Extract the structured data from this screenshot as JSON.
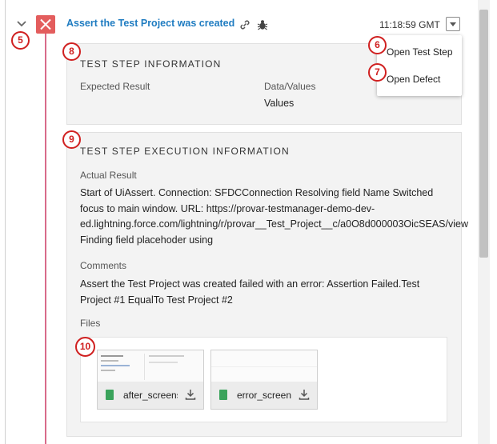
{
  "step": {
    "title": "Assert the Test Project was created",
    "time": "11:18:59 GMT"
  },
  "menu": {
    "open_test_step": "Open Test Step",
    "open_defect": "Open Defect"
  },
  "info": {
    "heading": "TEST STEP INFORMATION",
    "expected_label": "Expected Result",
    "data_label": "Data/Values",
    "data_value": "Values"
  },
  "exec": {
    "heading": "TEST STEP EXECUTION INFORMATION",
    "actual_label": "Actual Result",
    "actual_lines": [
      "Start of UiAssert. Connection: SFDCConnection Resolving field Name Switched",
      "focus to main window. URL: https://provar-testmanager-demo-dev-",
      "ed.lightning.force.com/lightning/r/provar__Test_Project__c/a0O8d000003OicSEAS/view",
      "Finding field placehoder using"
    ],
    "comments_label": "Comments",
    "comments_lines": [
      "Assert the Test Project was created failed with an error: Assertion Failed.Test",
      "Project #1 EqualTo Test Project #2"
    ],
    "files_label": "Files",
    "files": [
      {
        "name": "after_screenshot.png"
      },
      {
        "name": "error_screenshot.png"
      }
    ]
  },
  "badges": [
    "5",
    "6",
    "7",
    "8",
    "9",
    "10"
  ],
  "colors": {
    "link": "#1f7cc1",
    "fail": "#e35d5d",
    "timeline": "#d86b8a",
    "badge": "#d02020",
    "file_icon": "#3aa35b"
  }
}
